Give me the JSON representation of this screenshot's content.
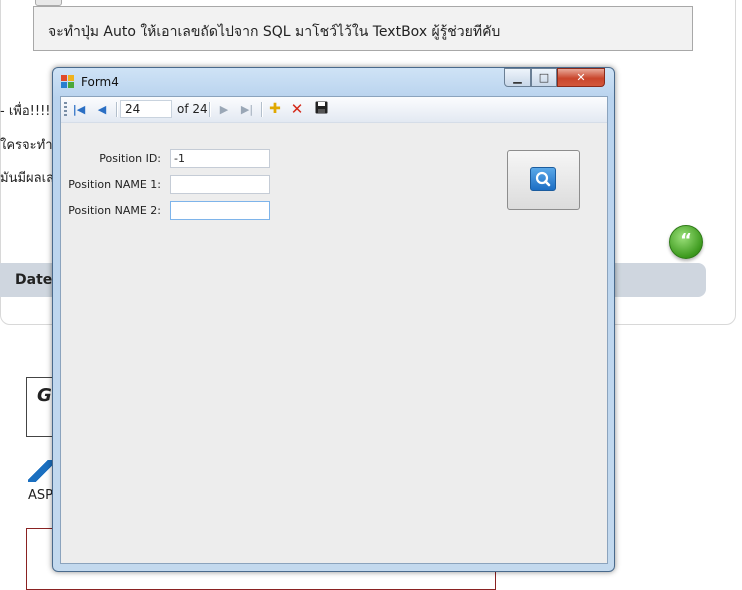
{
  "background": {
    "question_text": "จะทำปุ่ม Auto ให้เอาเลขถัดไปจาก SQL มาโชว์ไว้ใน TextBox ผู้รู้ช่วยทีคับ",
    "left_fragments": [
      "- เพื่อ!!!!",
      "ใครจะทำ",
      "มันมีผลเล"
    ],
    "date_label": "Date",
    "quote_icon": "quote-icon",
    "ad_text": "ASP",
    "ad_logo_letters": "Gl"
  },
  "window": {
    "title": "Form4",
    "controls": {
      "minimize": "▁",
      "maximize": "□",
      "close": "✕"
    }
  },
  "toolbar": {
    "position": "24",
    "of_label": "of 24",
    "buttons": [
      {
        "name": "move-first",
        "icon": "first-icon",
        "glyph": "|◀"
      },
      {
        "name": "move-previous",
        "icon": "previous-icon",
        "glyph": "◀"
      },
      {
        "name": "move-next",
        "icon": "next-icon",
        "glyph": "▶"
      },
      {
        "name": "move-last",
        "icon": "last-icon",
        "glyph": "▶|"
      },
      {
        "name": "add-new",
        "icon": "plus-icon",
        "glyph": "✚"
      },
      {
        "name": "delete",
        "icon": "delete-icon",
        "glyph": "✕"
      },
      {
        "name": "save",
        "icon": "save-icon",
        "glyph": "💾"
      }
    ]
  },
  "form": {
    "fields": [
      {
        "label": "Position ID:",
        "value": "-1"
      },
      {
        "label": "Position NAME 1:",
        "value": ""
      },
      {
        "label": "Position NAME 2:",
        "value": ""
      }
    ],
    "search_button_icon": "search-icon"
  },
  "colors": {
    "accent": "#1d6ec4",
    "close_red": "#c9462c",
    "plus_yellow": "#e0a800",
    "delete_red": "#d42a1a"
  }
}
